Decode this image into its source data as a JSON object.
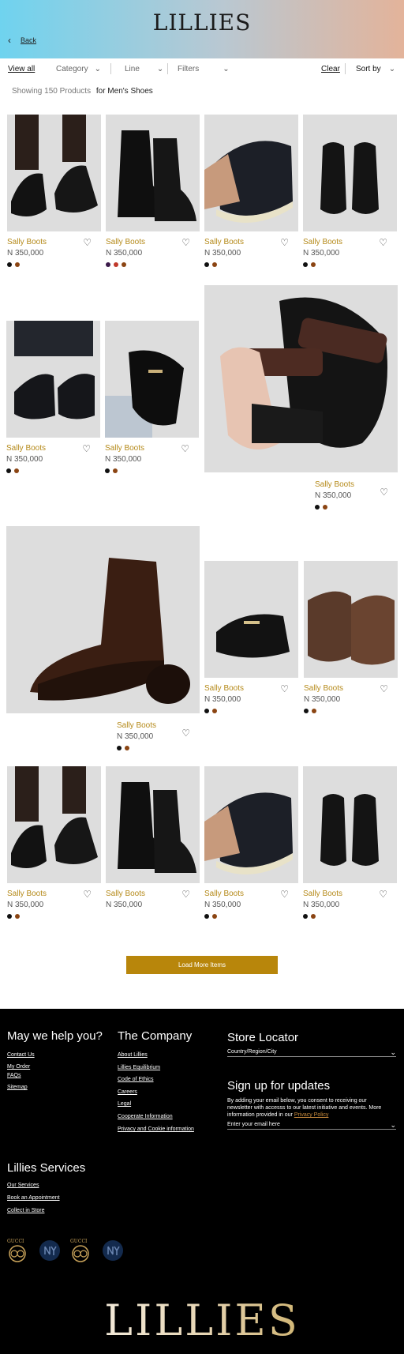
{
  "header": {
    "logo": "LILLIES",
    "back_label": "Back"
  },
  "filters": {
    "view_all": "View all",
    "category": "Category",
    "line": "Line",
    "filters": "Filters",
    "clear": "Clear",
    "sort_by": "Sort by"
  },
  "results": {
    "showing": "Showing 150 Products",
    "for": "for Men's Shoes"
  },
  "product": {
    "name": "Sally Boots",
    "price": "N 350,000"
  },
  "products": [
    {
      "name": "Sally Boots",
      "price": "N 350,000",
      "swatches": [
        "#111111",
        "#8b4513"
      ]
    },
    {
      "name": "Sally Boots",
      "price": "N 350,000",
      "swatches": [
        "#3b1a4a",
        "#c0392b",
        "#8b4513"
      ]
    },
    {
      "name": "Sally Boots",
      "price": "N 350,000",
      "swatches": [
        "#111111",
        "#8b4513"
      ]
    },
    {
      "name": "Sally Boots",
      "price": "N 350,000",
      "swatches": [
        "#111111",
        "#8b4513"
      ]
    }
  ],
  "load_more": "Load More Items",
  "footer": {
    "help_title": "May we help you?",
    "help_links": [
      "Contact Us",
      "My Order",
      "FAQs",
      "Sitemap"
    ],
    "company_title": "The Company",
    "company_links": [
      "About Lillies",
      "Lillies Equilibrium",
      "Code of Ethics",
      "Careers",
      "Legal",
      "Cooperate Information",
      "Privacy and Cookie information"
    ],
    "store_title": "Store Locator",
    "store_field": "Country/Region/City",
    "signup_title": "Sign up for updates",
    "signup_text": "By adding your email below, you consent to receiving our newsletter with accesss to our latest initiative and events. More information provided in our",
    "privacy_link": "Privacy Policy",
    "email_placeholder": "Enter your email here",
    "services_title": "Lillies Services",
    "services_links": [
      "Our Services",
      "Book an Appointment",
      "Collect in Store"
    ],
    "brand_gucci": "GUCCI",
    "big_logo": "LILLIES"
  },
  "colors": {
    "accent": "#b8860b",
    "price_name": "#b58a1a",
    "footer_bg": "#000000"
  }
}
